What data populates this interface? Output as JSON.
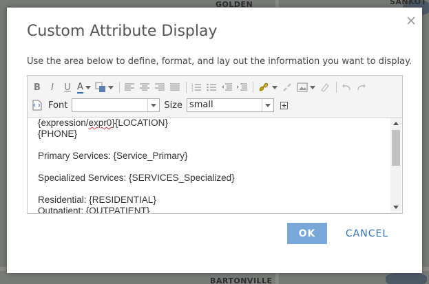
{
  "map": {
    "label_top": "GOLDEN",
    "label_top_right": "SANKOT",
    "label_bottom": "BARTONVILLE"
  },
  "dialog": {
    "title": "Custom Attribute Display",
    "close_icon": "close-icon",
    "instructions": "Use the area below to define, format, and lay out the information you want to display."
  },
  "toolbar": {
    "bold": "B",
    "italic": "I",
    "underline": "U",
    "font_color": "A",
    "font_label": "Font",
    "font_value": "",
    "size_label": "Size",
    "size_value": "small"
  },
  "content": {
    "line1_prefix": "{expression/",
    "line1_squiggle": "expr0",
    "line1_suffix": "}{LOCATION}",
    "line2": "{PHONE}",
    "line3": "Primary Services: {Service_Primary}",
    "line4": "Specialized Services: {SERVICES_Specialized}",
    "line5": "Residential: {RESIDENTIAL}",
    "line6": "Outpatient: {OUTPATIENT}"
  },
  "buttons": {
    "ok": "OK",
    "cancel": "CANCEL"
  },
  "colors": {
    "accent": "#78a8d9",
    "link": "#2f6fb3"
  }
}
